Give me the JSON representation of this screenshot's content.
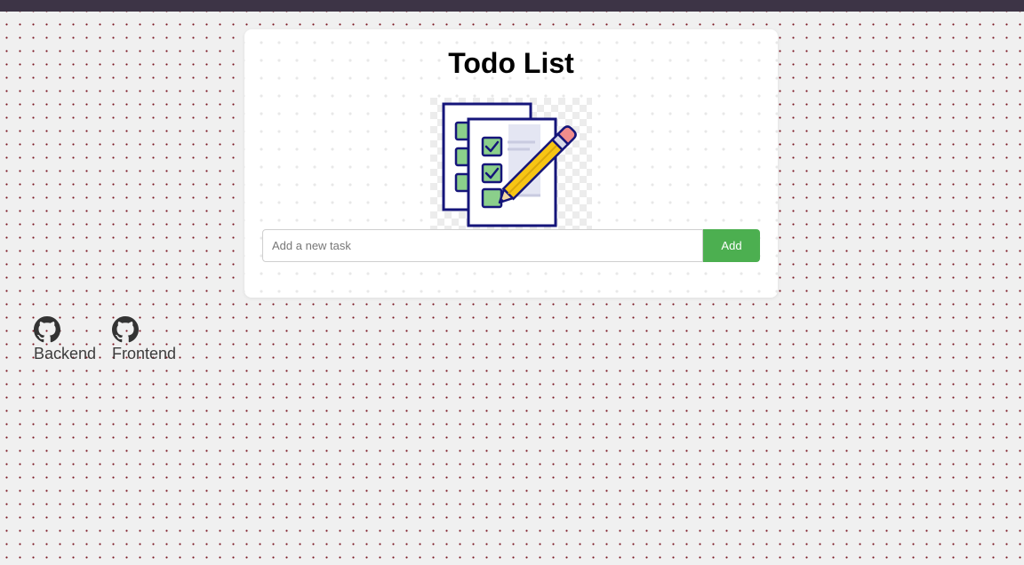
{
  "app": {
    "title": "Todo List"
  },
  "task_form": {
    "placeholder": "Add a new task",
    "value": "",
    "add_label": "Add"
  },
  "links": [
    {
      "label": "Backend",
      "icon": "github-icon"
    },
    {
      "label": "Frontend",
      "icon": "github-icon"
    }
  ],
  "colors": {
    "add_button": "#4caf50",
    "top_bar": "#3d3446",
    "background": "#f0f0f0",
    "dot_pattern": "#7a1420"
  },
  "hero_image": {
    "icon": "checklist-with-pencil-icon"
  }
}
